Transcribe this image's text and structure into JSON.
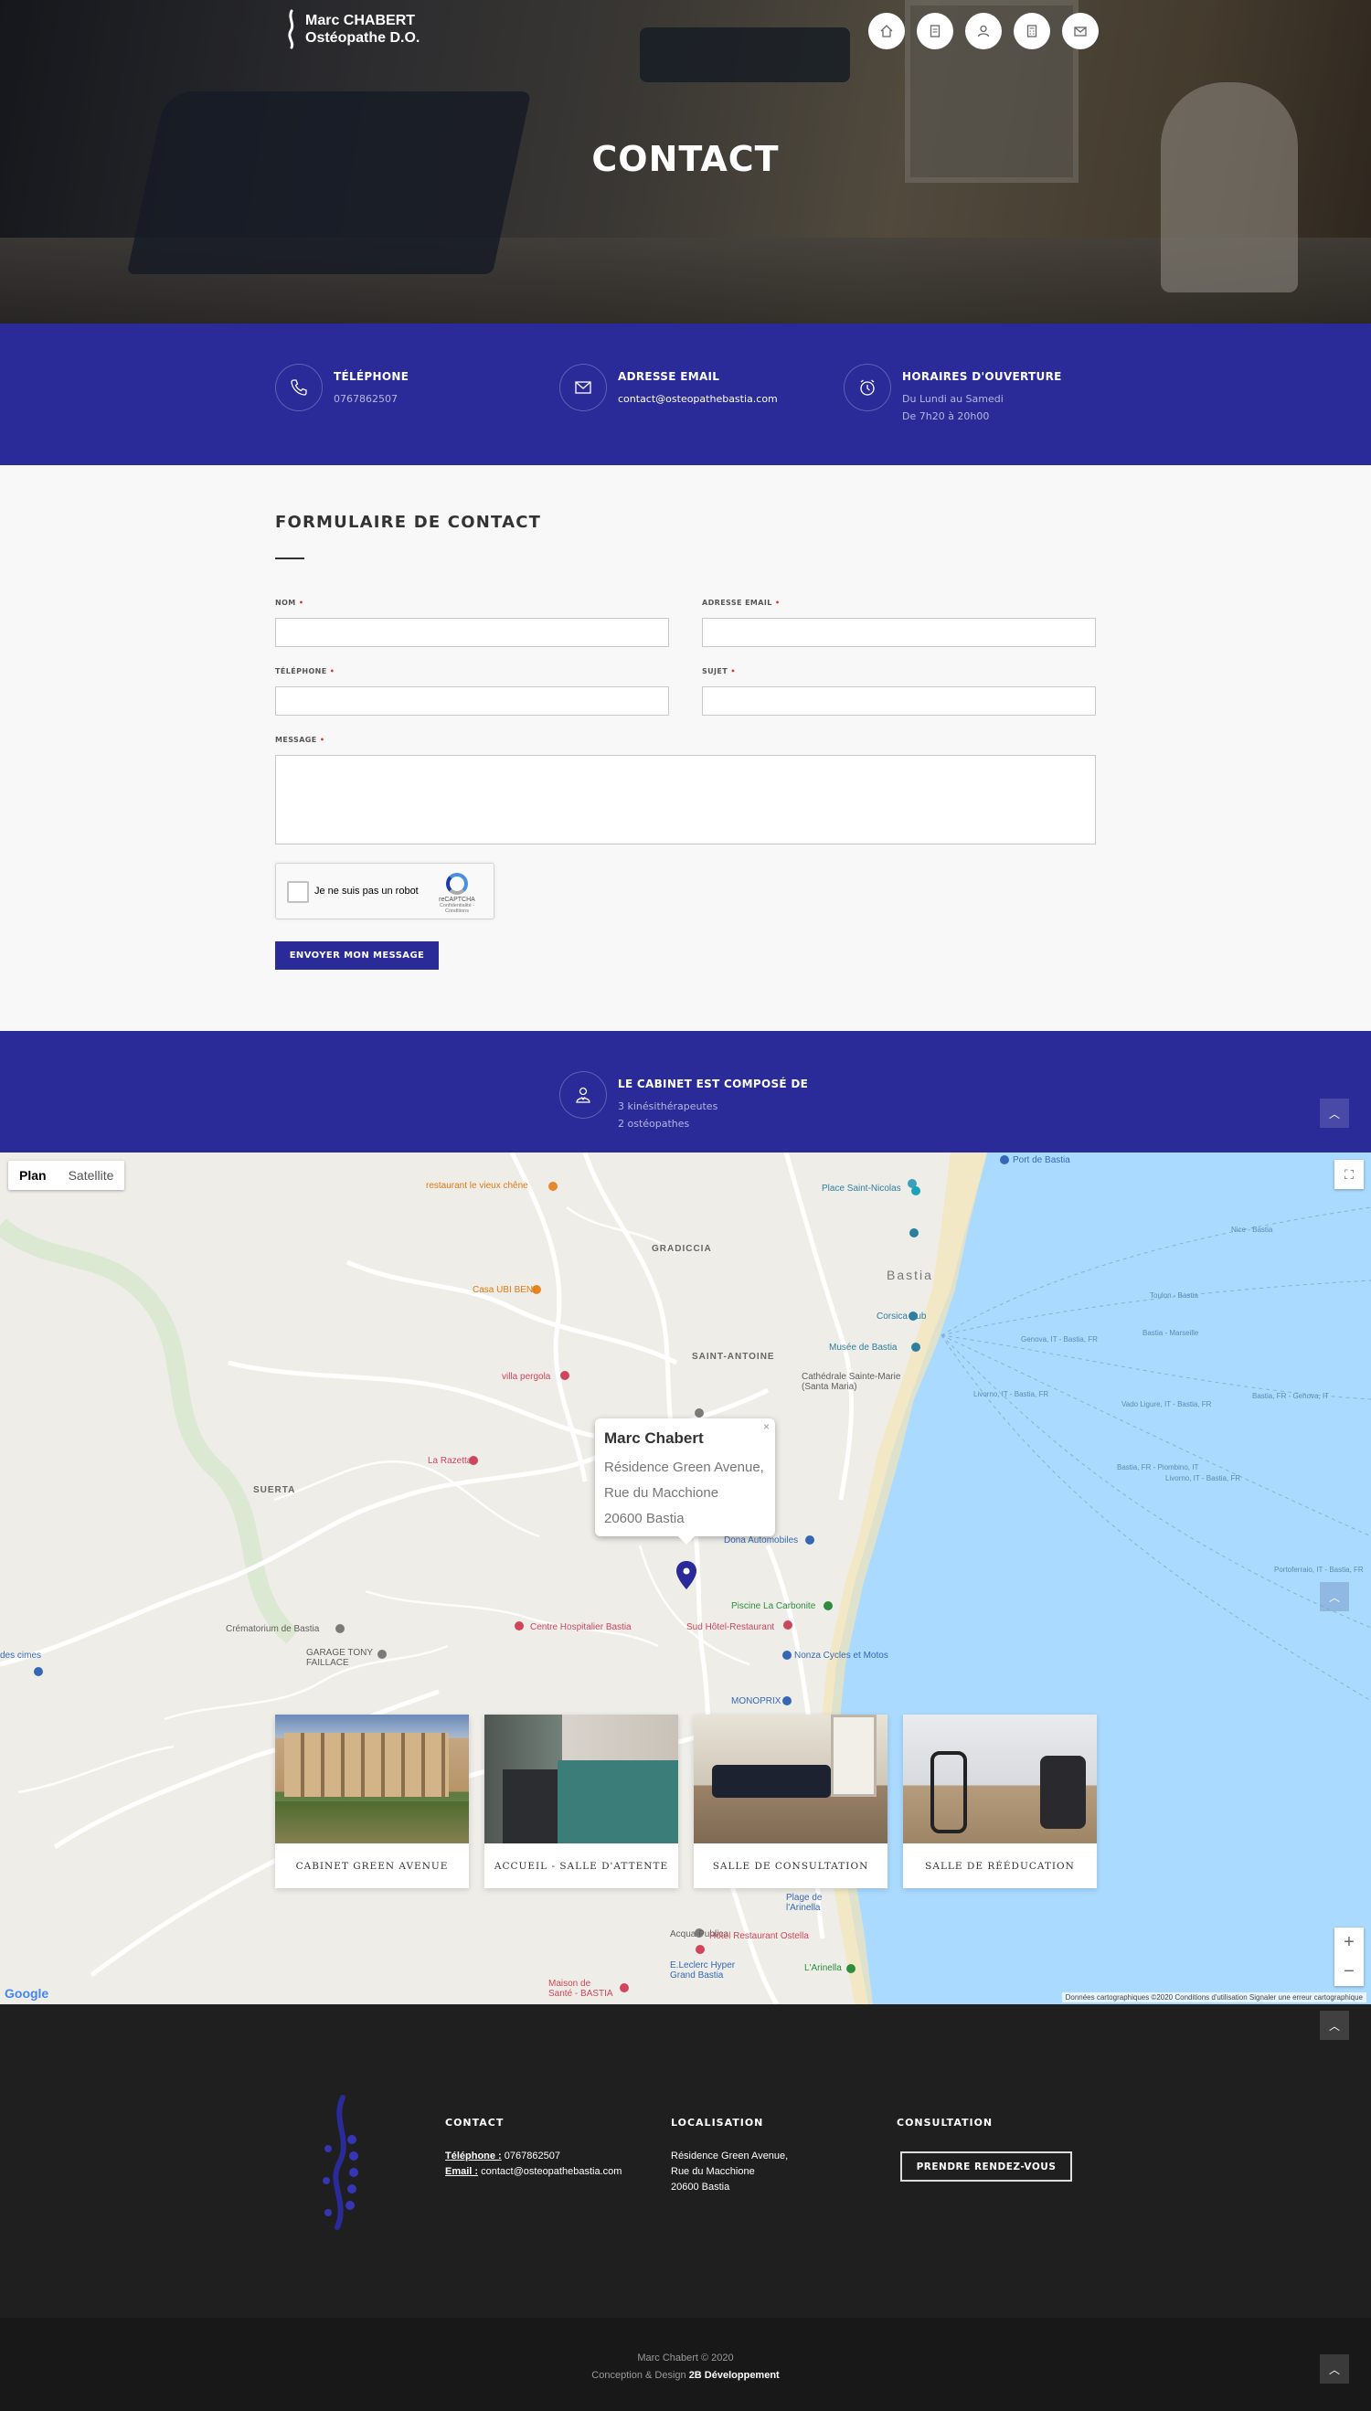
{
  "brand": {
    "line1": "Marc CHABERT",
    "line2": "Ostéopathe D.O."
  },
  "top_nav": [
    "home-icon",
    "document-icon",
    "user-icon",
    "calculator-icon",
    "mail-icon"
  ],
  "hero": {
    "title": "CONTACT"
  },
  "info": {
    "phone": {
      "title": "TÉLÉPHONE",
      "value": "0767862507"
    },
    "email": {
      "title": "ADRESSE EMAIL",
      "value": "contact@osteopathebastia.com"
    },
    "hours": {
      "title": "HORAIRES D'OUVERTURE",
      "line1": "Du Lundi au Samedi",
      "line2": "De 7h20 à 20h00"
    }
  },
  "form": {
    "title": "FORMULAIRE DE CONTACT",
    "name_label": "NOM",
    "email_label": "ADRESSE EMAIL",
    "phone_label": "TÉLÉPHONE",
    "subject_label": "SUJET",
    "message_label": "MESSAGE",
    "required_mark": "•",
    "captcha_label": "Je ne suis pas un robot",
    "captcha_brand": "reCAPTCHA",
    "captcha_links": "Confidentialité - Conditions",
    "submit": "ENVOYER MON MESSAGE"
  },
  "cabinet": {
    "title": "LE CABINET EST COMPOSÉ DE",
    "line1": "3 kinésithérapeutes",
    "line2": "2 ostéopathes"
  },
  "map": {
    "tab_plan": "Plan",
    "tab_satellite": "Satellite",
    "zoom_in": "+",
    "zoom_out": "−",
    "popup": {
      "title": "Marc Chabert",
      "line1": "Résidence Green Avenue,",
      "line2": "Rue du Macchione",
      "line3": "20600 Bastia",
      "close": "×"
    },
    "attribution": "Données cartographiques ©2020    Conditions d'utilisation    Signaler une erreur cartographique",
    "google": "Google",
    "labels": {
      "restaurant": "restaurant le vieux chêne",
      "gradiccia": "GRADICCIA",
      "casa": "Casa UBI BENE",
      "saint_antoine": "SAINT-ANTOINE",
      "villa": "villa pergola",
      "razetta": "La Razetta",
      "suerta": "SUERTA",
      "crematorium": "Crématorium de Bastia",
      "garage": "GARAGE TONY\nFAILLACE",
      "centre": "Centre Hospitalier Bastia",
      "sud_hotel": "Sud Hôtel-Restaurant",
      "piscine": "Piscine La Carbonite",
      "nonza": "Nonza Cycles et Motos",
      "monoprix": "MONOPRIX",
      "dona": "Dona Automobiles",
      "place": "Place Saint-Nicolas",
      "bastia": "Bastia",
      "corsica": "Corsica Sub",
      "musee": "Musée de Bastia",
      "cathedrale": "Cathédrale Sainte-Marie\n(Santa Maria)",
      "port": "Port de Bastia",
      "des_cimes": "des cimes",
      "acqua": "Acqua Publica",
      "hotel_ostella": "Hôtel Restaurant Ostella",
      "arinella": "L'Arinella",
      "leclerc": "E.Leclerc Hyper\nGrand Bastia",
      "maison": "Maison de\nSanté - BASTIA",
      "plage": "Plage de\nl'Arinella",
      "nice": "Nice - Bastia",
      "toulon": "Toulon - Bastia",
      "marseille": "Bastia - Marseille",
      "genova": "Bastia, FR - Genova, IT",
      "genova2": "Genova, IT - Bastia, FR",
      "livorno": "Livorno, IT - Bastia, FR",
      "vado": "Vado Ligure, IT - Bastia, FR",
      "piombino": "Bastia, FR - Piombino, IT",
      "livorno2": "Livorno, IT - Bastia, FR",
      "portoferraio": "Portoferraio, IT - Bastia, FR"
    }
  },
  "gallery": [
    {
      "caption": "CABINET GREEN AVENUE"
    },
    {
      "caption": "ACCUEIL - SALLE D'ATTENTE"
    },
    {
      "caption": "SALLE DE CONSULTATION"
    },
    {
      "caption": "SALLE DE RÉÉDUCATION"
    }
  ],
  "footer": {
    "contact_title": "CONTACT",
    "phone_label": "Téléphone :",
    "phone": "0767862507",
    "email_label": "Email :",
    "email": "contact@osteopathebastia.com",
    "loc_title": "LOCALISATION",
    "loc1": "Résidence Green Avenue,",
    "loc2": "Rue du Macchione",
    "loc3": "20600 Bastia",
    "consult_title": "CONSULTATION",
    "rdv": "PRENDRE RENDEZ-VOUS",
    "copyright": "Marc Chabert © 2020",
    "credit_prefix": "Conception & Design",
    "credit": "2B Développement"
  },
  "colors": {
    "accent": "#2a2a99",
    "footer": "#1f1f1f",
    "sea": "#aadaff"
  }
}
